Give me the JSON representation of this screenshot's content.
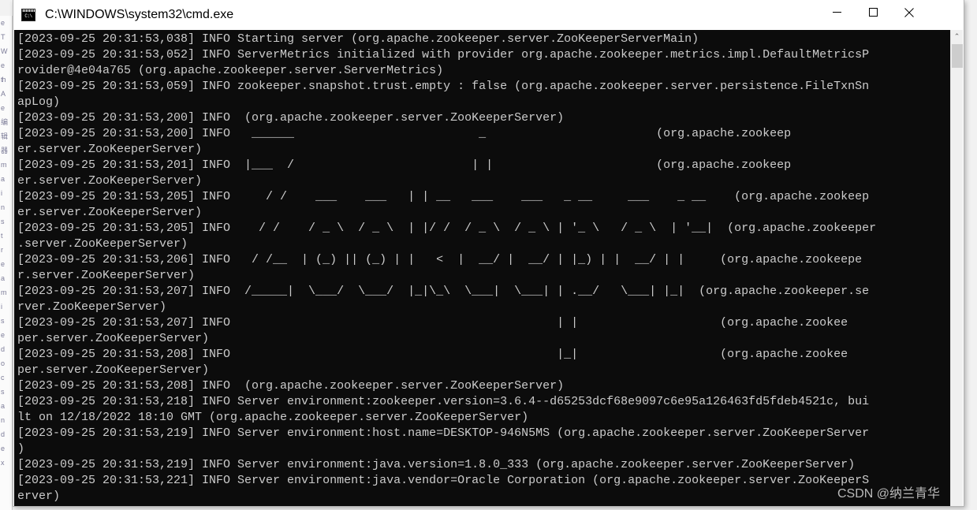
{
  "window": {
    "title": "C:\\WINDOWS\\system32\\cmd.exe",
    "app_icon": "cmd-icon",
    "controls": {
      "minimize": "—",
      "maximize": "☐",
      "close": "✕"
    }
  },
  "scrollbar": {
    "up_arrow": "⌃"
  },
  "watermark": {
    "text": "CSDN @纳兰青华"
  },
  "background_window": {
    "edge_chars": [
      "e",
      "T",
      "W",
      "e",
      "th",
      "A",
      "e",
      "编",
      "辑",
      "器",
      "m",
      "a",
      "i",
      "n",
      "s",
      "t",
      "r",
      "e",
      "a",
      "m",
      "i",
      "s",
      "e",
      "d",
      "o",
      "c",
      "s",
      "a",
      "n",
      "d",
      "e",
      "x"
    ]
  },
  "terminal": {
    "background": "#0c0c0c",
    "foreground": "#cccccc",
    "lines": [
      "[2023-09-25 20:31:53,038] INFO Starting server (org.apache.zookeeper.server.ZooKeeperServerMain)",
      "[2023-09-25 20:31:53,052] INFO ServerMetrics initialized with provider org.apache.zookeeper.metrics.impl.DefaultMetricsP",
      "rovider@4e04a765 (org.apache.zookeeper.server.ServerMetrics)",
      "[2023-09-25 20:31:53,059] INFO zookeeper.snapshot.trust.empty : false (org.apache.zookeeper.server.persistence.FileTxnSn",
      "apLog)",
      "[2023-09-25 20:31:53,200] INFO  (org.apache.zookeeper.server.ZooKeeperServer)",
      "[2023-09-25 20:31:53,200] INFO   ______                          _                        (org.apache.zookeep",
      "er.server.ZooKeeperServer)",
      "[2023-09-25 20:31:53,201] INFO  |___  /                         | |                       (org.apache.zookeep",
      "er.server.ZooKeeperServer)",
      "[2023-09-25 20:31:53,205] INFO     / /    ___    ___   | | __   ___    ___   _ __     ___    _ __    (org.apache.zookeep",
      "er.server.ZooKeeperServer)",
      "[2023-09-25 20:31:53,205] INFO    / /    / _ \\  / _ \\  | |/ /  / _ \\  / _ \\ | '_ \\   / _ \\  | '__|  (org.apache.zookeeper",
      ".server.ZooKeeperServer)",
      "[2023-09-25 20:31:53,206] INFO   / /__  | (_) || (_) | |   <  |  __/ |  __/ | |_) | |  __/ | |     (org.apache.zookeepe",
      "r.server.ZooKeeperServer)",
      "[2023-09-25 20:31:53,207] INFO  /_____|  \\___/  \\___/  |_|\\_\\  \\___|  \\___| | .__/   \\___| |_|  (org.apache.zookeeper.se",
      "rver.ZooKeeperServer)",
      "[2023-09-25 20:31:53,207] INFO                                              | |                    (org.apache.zookee",
      "per.server.ZooKeeperServer)",
      "[2023-09-25 20:31:53,208] INFO                                              |_|                    (org.apache.zookee",
      "per.server.ZooKeeperServer)",
      "[2023-09-25 20:31:53,208] INFO  (org.apache.zookeeper.server.ZooKeeperServer)",
      "[2023-09-25 20:31:53,218] INFO Server environment:zookeeper.version=3.6.4--d65253dcf68e9097c6e95a126463fd5fdeb4521c, bui",
      "lt on 12/18/2022 18:10 GMT (org.apache.zookeeper.server.ZooKeeperServer)",
      "[2023-09-25 20:31:53,219] INFO Server environment:host.name=DESKTOP-946N5MS (org.apache.zookeeper.server.ZooKeeperServer",
      ")",
      "[2023-09-25 20:31:53,219] INFO Server environment:java.version=1.8.0_333 (org.apache.zookeeper.server.ZooKeeperServer)",
      "[2023-09-25 20:31:53,221] INFO Server environment:java.vendor=Oracle Corporation (org.apache.zookeeper.server.ZooKeeperS",
      "erver)"
    ]
  }
}
